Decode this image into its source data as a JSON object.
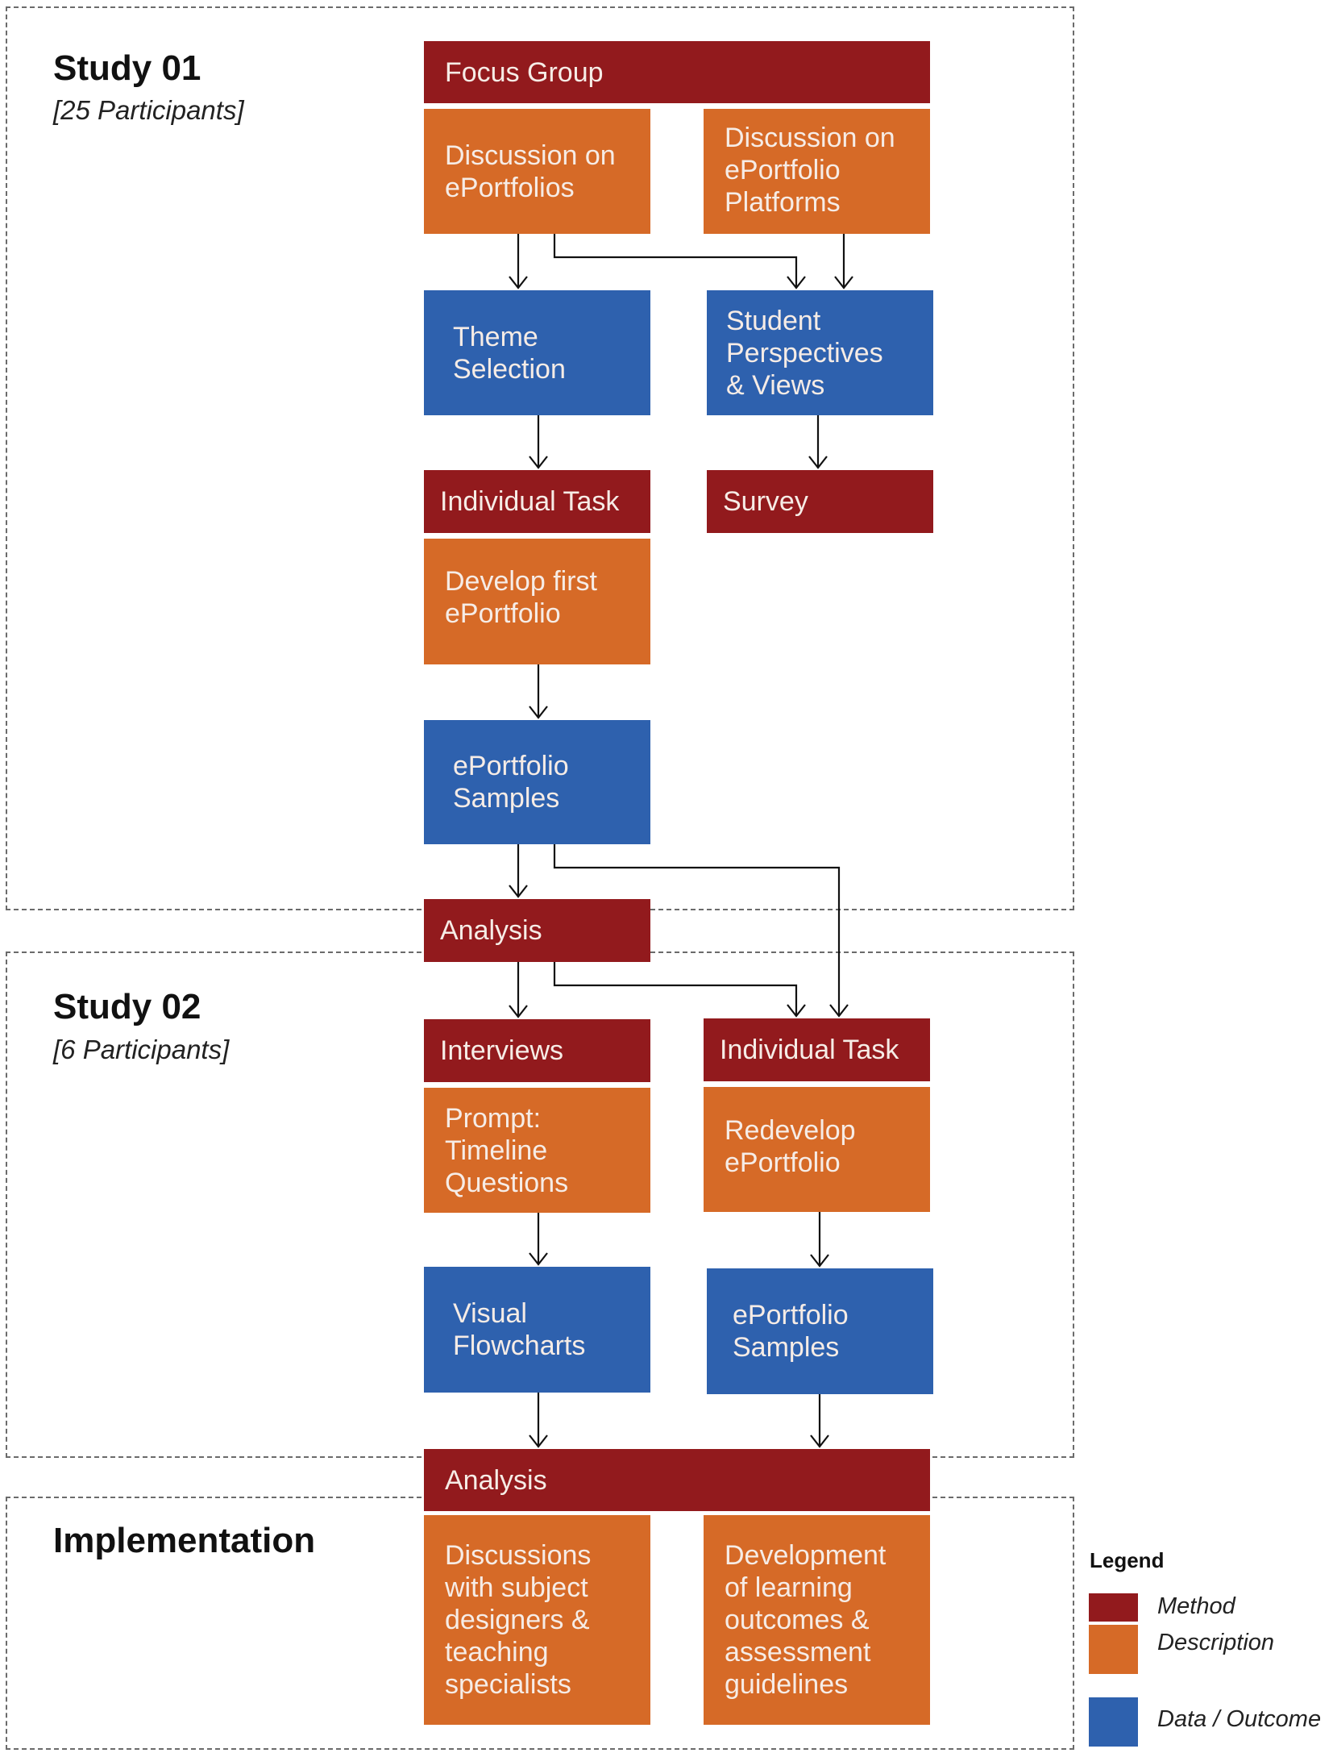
{
  "sections": {
    "study1": {
      "title": "Study 01",
      "subtitle": "[25 Participants]"
    },
    "study2": {
      "title": "Study 02",
      "subtitle": "[6 Participants]"
    },
    "implementation": {
      "title": "Implementation"
    }
  },
  "nodes": {
    "focus_group": "Focus Group",
    "discussion_eportfolios": "Discussion on\nePortfolios",
    "discussion_platforms": "Discussion on\nePortfolio\nPlatforms",
    "theme_selection": "Theme\nSelection",
    "student_perspectives": "Student\nPerspectives\n& Views",
    "individual_task_1": "Individual Task",
    "survey": "Survey",
    "develop_first": "Develop first\nePortfolio",
    "eportfolio_samples_1": "ePortfolio\nSamples",
    "analysis_1": "Analysis",
    "interviews": "Interviews",
    "individual_task_2": "Individual Task",
    "prompt_timeline": "Prompt:\nTimeline\nQuestions",
    "redevelop": "Redevelop\nePortfolio",
    "visual_flowcharts": "Visual\nFlowcharts",
    "eportfolio_samples_2": "ePortfolio\nSamples",
    "analysis_2": "Analysis",
    "discussions_designers": "Discussions\nwith subject\ndesigners &\nteaching\nspecialists",
    "development_outcomes": "Development\nof learning\noutcomes &\nassessment\nguidelines"
  },
  "legend": {
    "title": "Legend",
    "items": [
      {
        "label": "Method",
        "color": "#921a1d"
      },
      {
        "label": "Description",
        "color": "#d66a27"
      },
      {
        "label": "Data / Outcome",
        "color": "#2e61ae"
      }
    ]
  },
  "colors": {
    "method": "#921a1d",
    "description": "#d66a27",
    "data_outcome": "#2e61ae"
  }
}
